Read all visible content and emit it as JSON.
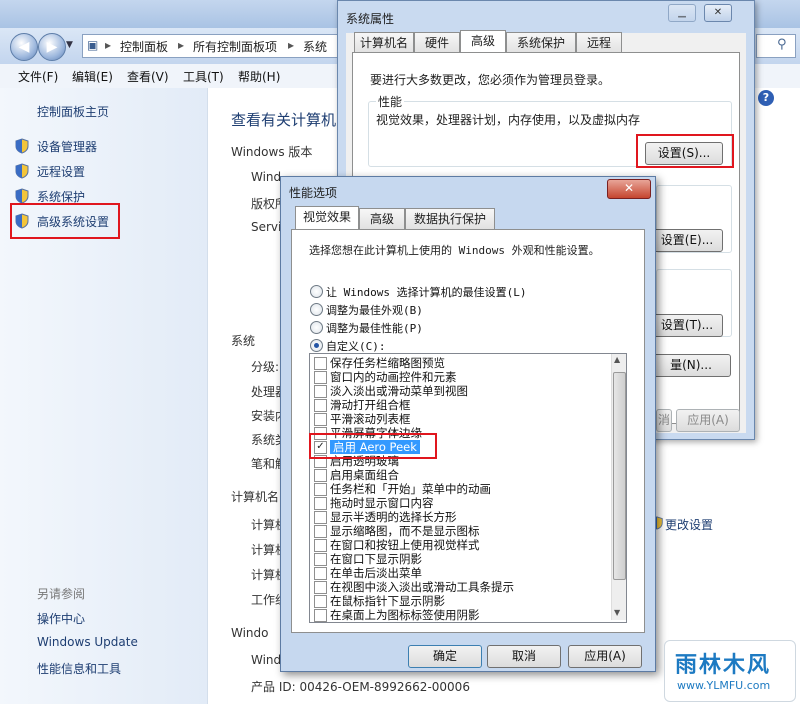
{
  "control_panel": {
    "breadcrumb": [
      "控制面板",
      "所有控制面板项",
      "系统"
    ],
    "menu": [
      "文件(F)",
      "编辑(E)",
      "查看(V)",
      "工具(T)",
      "帮助(H)"
    ],
    "sidebar": {
      "home": "控制面板主页",
      "items": [
        "设备管理器",
        "远程设置",
        "系统保护",
        "高级系统设置"
      ],
      "see_also_title": "另请参阅",
      "see_also": [
        "操作中心",
        "Windows Update",
        "性能信息和工具"
      ]
    },
    "content": {
      "heading": "查看有关计算机",
      "windows_edition": "Windows 版本",
      "edition_rows": [
        "Wind",
        "版权所",
        "Servi"
      ],
      "system_section": "系统",
      "system_rows": [
        "分级:",
        "处理器",
        "安装内",
        "系统类",
        "笔和触"
      ],
      "computer_name_section": "计算机名",
      "computer_rows": [
        "计算机",
        "计算机",
        "计算机",
        "工作组"
      ],
      "change_settings": "更改设置",
      "activation_section": "Windo",
      "activation_rows": [
        "Wind"
      ],
      "product_id": "产品 ID: 00426-OEM-8992662-00006"
    }
  },
  "system_properties": {
    "title": "系统属性",
    "tabs": [
      "计算机名",
      "硬件",
      "高级",
      "系统保护",
      "远程"
    ],
    "active_tab": "高级",
    "admin_note": "要进行大多数更改，您必须作为管理员登录。",
    "performance_group": "性能",
    "performance_desc": "视觉效果，处理器计划，内存使用，以及虚拟内存",
    "settings_button": "设置(S)...",
    "settings_button_2": "设置(E)...",
    "settings_button_3": "设置(T)...",
    "env_button_partial": "量(N)...",
    "cancel_partial": "消",
    "apply_button": "应用(A)"
  },
  "performance_options": {
    "title": "性能选项",
    "close_label": "✕",
    "tabs": [
      "视觉效果",
      "高级",
      "数据执行保护"
    ],
    "active_tab": "视觉效果",
    "intro": "选择您想在此计算机上使用的 Windows 外观和性能设置。",
    "radios": [
      {
        "label": "让 Windows 选择计算机的最佳设置(L)",
        "checked": false
      },
      {
        "label": "调整为最佳外观(B)",
        "checked": false
      },
      {
        "label": "调整为最佳性能(P)",
        "checked": false
      },
      {
        "label": "自定义(C):",
        "checked": true
      }
    ],
    "options": [
      {
        "label": "保存任务栏缩略图预览",
        "checked": false
      },
      {
        "label": "窗口内的动画控件和元素",
        "checked": false
      },
      {
        "label": "淡入淡出或滑动菜单到视图",
        "checked": false
      },
      {
        "label": "滑动打开组合框",
        "checked": false
      },
      {
        "label": "平滑滚动列表框",
        "checked": false
      },
      {
        "label": "平滑屏幕字体边缘",
        "checked": false
      },
      {
        "label": "启用 Aero Peek",
        "checked": true
      },
      {
        "label": "启用透明玻璃",
        "checked": false
      },
      {
        "label": "启用桌面组合",
        "checked": false
      },
      {
        "label": "任务栏和「开始」菜单中的动画",
        "checked": false
      },
      {
        "label": "拖动时显示窗口内容",
        "checked": false
      },
      {
        "label": "显示半透明的选择长方形",
        "checked": false
      },
      {
        "label": "显示缩略图，而不是显示图标",
        "checked": false
      },
      {
        "label": "在窗口和按钮上使用视觉样式",
        "checked": false
      },
      {
        "label": "在窗口下显示阴影",
        "checked": false
      },
      {
        "label": "在单击后淡出菜单",
        "checked": false
      },
      {
        "label": "在视图中淡入淡出或滑动工具条提示",
        "checked": false
      },
      {
        "label": "在鼠标指针下显示阴影",
        "checked": false
      },
      {
        "label": "在桌面上为图标标签使用阴影",
        "checked": false
      }
    ],
    "ok_button": "确定",
    "cancel_button": "取消",
    "apply_button": "应用(A)"
  },
  "watermark": {
    "brand": "雨林木风",
    "url": "www.YLMFU.com"
  },
  "colors": {
    "accent_red": "#e0161e",
    "selection": "#3399ff",
    "link": "#1e3e72"
  }
}
